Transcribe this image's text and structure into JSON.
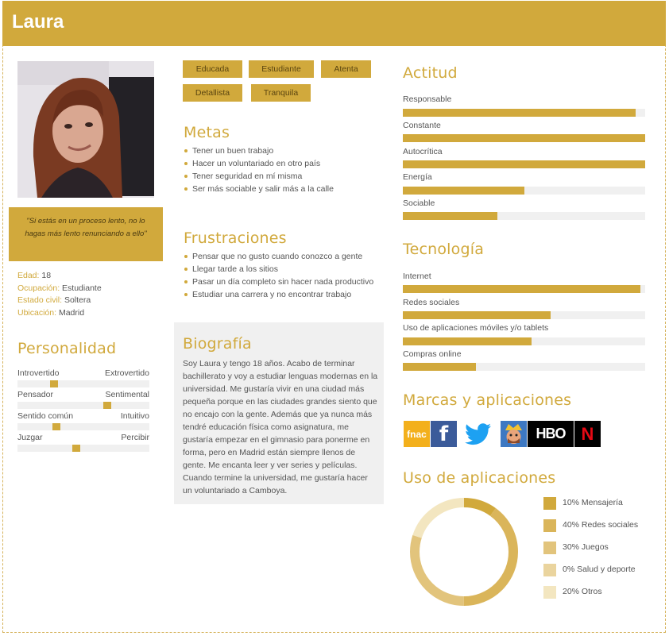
{
  "persona": {
    "name": "Laura"
  },
  "quote": "\"Si estás en un proceso lento, no lo hagas más lento renunciando a ello\"",
  "info": [
    {
      "label": "Edad:",
      "value": "18"
    },
    {
      "label": "Ocupación:",
      "value": "Estudiante"
    },
    {
      "label": "Estado civil:",
      "value": "Soltera"
    },
    {
      "label": "Ubicación:",
      "value": "Madrid"
    }
  ],
  "personality": {
    "title": "Personalidad",
    "scales": [
      {
        "left": "Introvertido",
        "right": "Extrovertido",
        "value": 0.26
      },
      {
        "left": "Pensador",
        "right": "Sentimental",
        "value": 0.69
      },
      {
        "left": "Sentido común",
        "right": "Intuitivo",
        "value": 0.28
      },
      {
        "left": "Juzgar",
        "right": "Percibir",
        "value": 0.44
      }
    ]
  },
  "tags": [
    "Educada",
    "Estudiante",
    "Atenta",
    "Detallista",
    "Tranquila"
  ],
  "goals": {
    "title": "Metas",
    "items": [
      "Tener un buen trabajo",
      "Hacer un voluntariado en otro país",
      "Tener seguridad en mí misma",
      "Ser más sociable y salir más a la calle"
    ]
  },
  "frustrations": {
    "title": "Frustraciones",
    "items": [
      "Pensar que no gusto cuando conozco a gente",
      "Llegar tarde a los sitios",
      "Pasar un día completo sin hacer nada productivo",
      "Estudiar una carrera y no encontrar trabajo"
    ]
  },
  "biography": {
    "title": "Biografía",
    "text": "Soy Laura y tengo 18 años. Acabo de terminar bachillerato y voy a estudiar lenguas modernas en la universidad. Me gustaría vivir en una ciudad más pequeña porque en las ciudades grandes siento que no encajo con la gente. Además que ya nunca más tendré educación física como asignatura, me gustaría empezar en el gimnasio para ponerme en forma, pero en Madrid están siempre llenos de gente. Me encanta leer y ver series y películas. Cuando termine la universidad, me gustaría hacer un voluntariado a Camboya."
  },
  "attitude": {
    "title": "Actitud",
    "bars": [
      {
        "label": "Responsable",
        "value": 0.96
      },
      {
        "label": "Constante",
        "value": 1.0
      },
      {
        "label": "Autocrítica",
        "value": 1.0
      },
      {
        "label": "Energía",
        "value": 0.5
      },
      {
        "label": "Sociable",
        "value": 0.39
      }
    ]
  },
  "technology": {
    "title": "Tecnología",
    "bars": [
      {
        "label": "Internet",
        "value": 0.98
      },
      {
        "label": "Redes sociales",
        "value": 0.61
      },
      {
        "label": "Uso de aplicaciones móviles y/o tablets",
        "value": 0.53
      },
      {
        "label": "Compras online",
        "value": 0.3
      }
    ]
  },
  "brands": {
    "title": "Marcas y aplicaciones",
    "items": [
      {
        "name": "fnac",
        "icon": "fnac-logo"
      },
      {
        "name": "f",
        "icon": "facebook-logo"
      },
      {
        "name": "",
        "icon": "twitter-logo"
      },
      {
        "name": "",
        "icon": "clash-royale-logo"
      },
      {
        "name": "HBO",
        "icon": "hbo-logo"
      },
      {
        "name": "N",
        "icon": "netflix-logo"
      }
    ]
  },
  "app_usage": {
    "title": "Uso de aplicaciones",
    "segments": [
      {
        "label": "10%  Mensajería",
        "value": 10,
        "color": "#d1a93c"
      },
      {
        "label": "40%  Redes sociales",
        "value": 40,
        "color": "#dab55a"
      },
      {
        "label": "30%  Juegos",
        "value": 30,
        "color": "#e2c47c"
      },
      {
        "label": "0%  Salud y deporte",
        "value": 0,
        "color": "#ead49e"
      },
      {
        "label": "20% Otros",
        "value": 20,
        "color": "#f3e6c0"
      }
    ]
  }
}
